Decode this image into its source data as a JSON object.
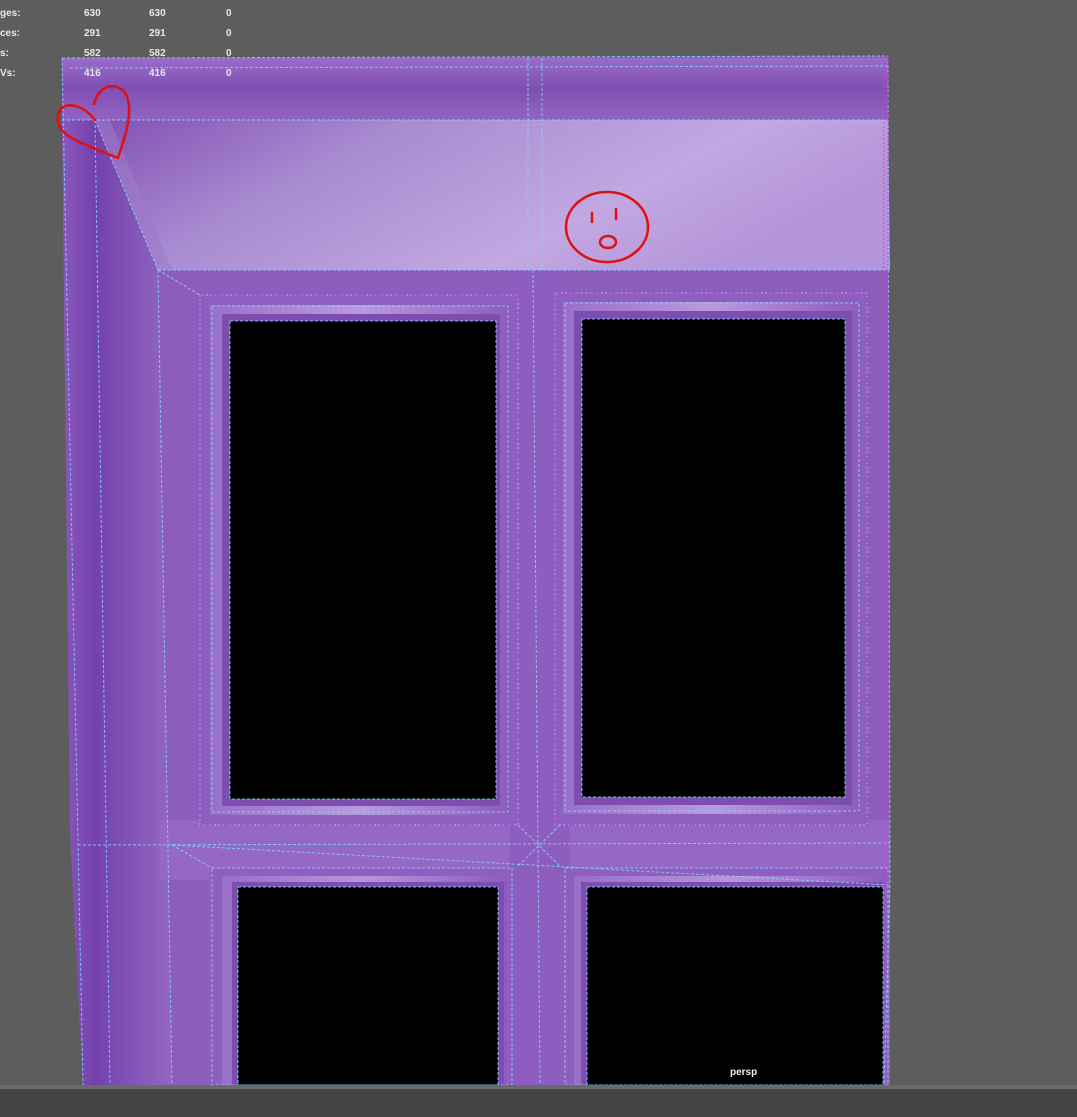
{
  "hud": {
    "rows": [
      {
        "label": "ges:",
        "selected": "630",
        "total": "630",
        "extra": "0"
      },
      {
        "label": "ces:",
        "selected": "291",
        "total": "291",
        "extra": "0"
      },
      {
        "label": "s:",
        "selected": "582",
        "total": "582",
        "extra": "0"
      },
      {
        "label": "Vs:",
        "selected": "416",
        "total": "416",
        "extra": "0"
      }
    ]
  },
  "viewport": {
    "camera_name": "persp",
    "background_color": "#5d5d5d",
    "mesh_color": "#8a5bb8",
    "wireframe_color": "#7fd8ff",
    "annotation_color": "#e01010"
  },
  "annotations": {
    "heart": "heart-doodle",
    "face": "surprised-face-doodle"
  }
}
